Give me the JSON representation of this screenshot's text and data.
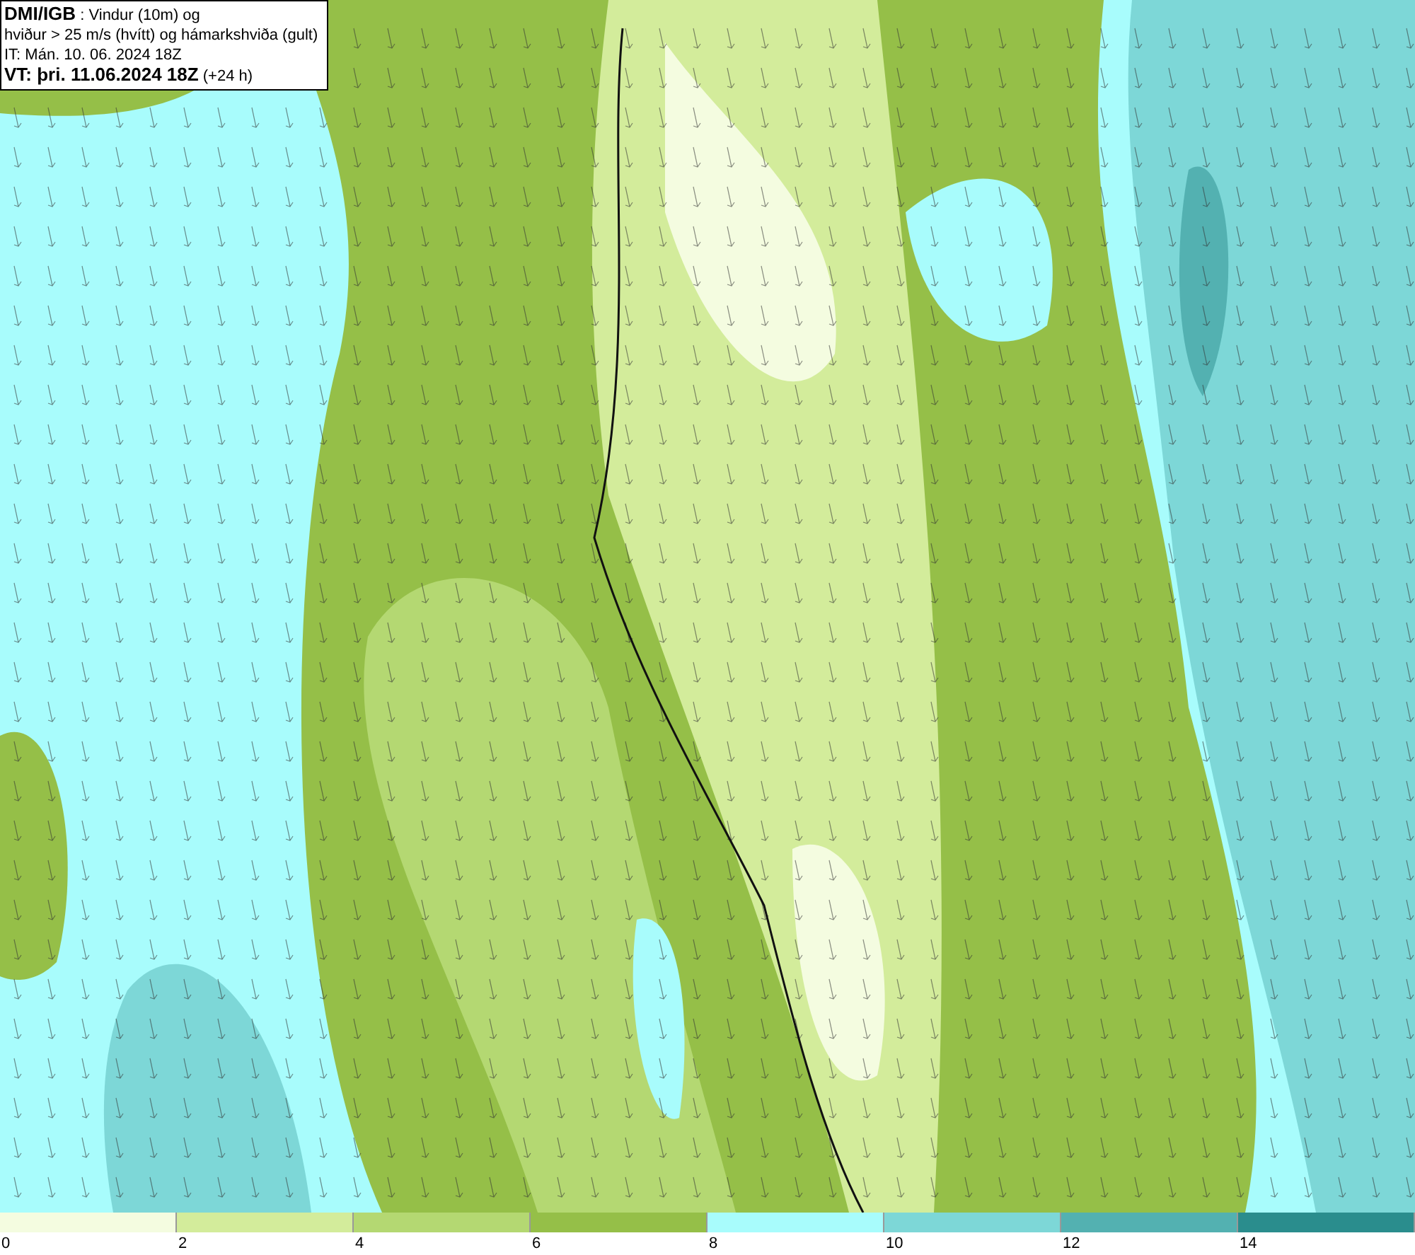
{
  "title_box": {
    "lines": [
      "**DMI/IGB** : Vindur (10m) og",
      "hviður > 25 m/s (hvítt) og hámarkshviða (gult)",
      "IT: Mán. 10. 06. 2024 18Z",
      "**VT: þri. 11.06.2024 18Z** (+24 h)"
    ]
  },
  "legend": {
    "bins": [
      {
        "label": "0",
        "color": "#f4fce0"
      },
      {
        "label": "2",
        "color": "#d3ec9b"
      },
      {
        "label": "4",
        "color": "#b4d872"
      },
      {
        "label": "6",
        "color": "#95bf48"
      },
      {
        "label": "8",
        "color": "#a8fcfc"
      },
      {
        "label": "10",
        "color": "#7dd7d7"
      },
      {
        "label": "12",
        "color": "#53b1b1"
      },
      {
        "label": "14",
        "color": "#2a8d8d"
      }
    ]
  }
}
